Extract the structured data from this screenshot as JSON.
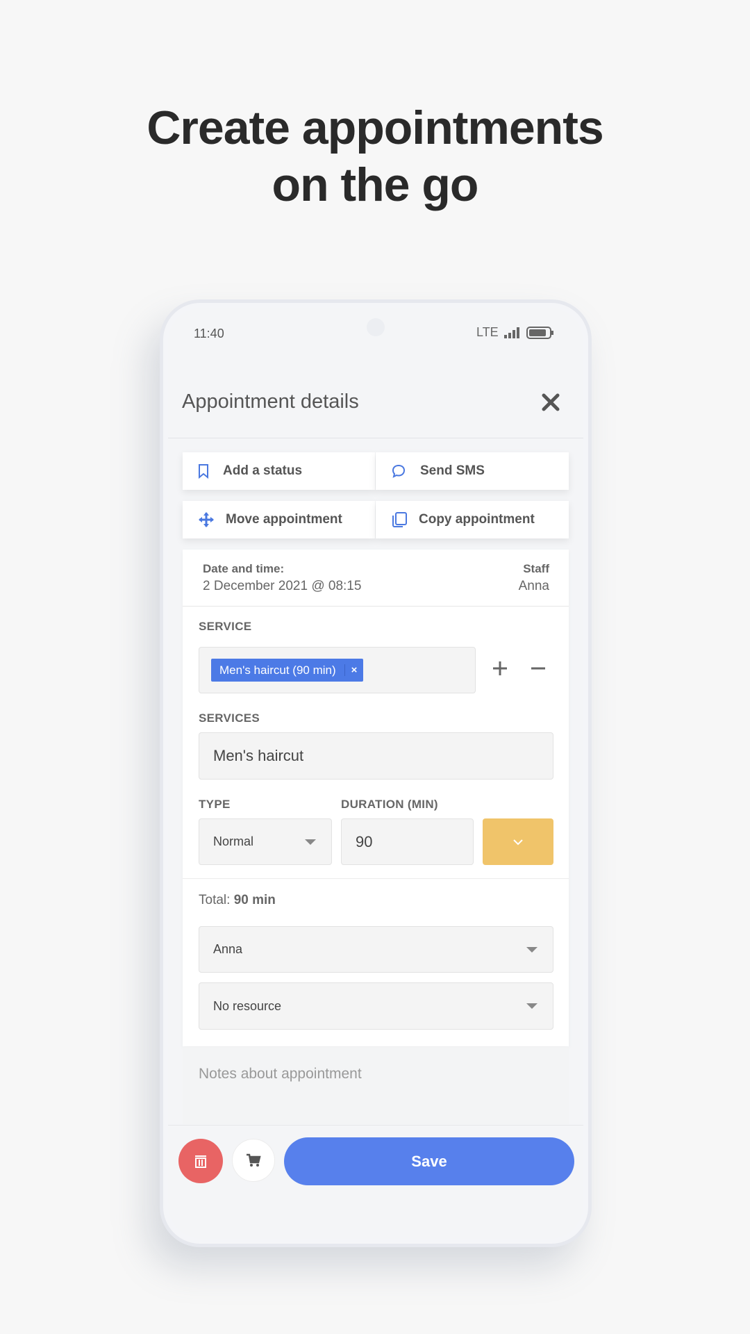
{
  "headline": {
    "line1": "Create appointments",
    "line2": "on the go"
  },
  "status_bar": {
    "time": "11:40",
    "network": "LTE"
  },
  "header": {
    "title": "Appointment details"
  },
  "actions": {
    "add_status": "Add a status",
    "send_sms": "Send SMS",
    "move": "Move appointment",
    "copy": "Copy appointment"
  },
  "info": {
    "date_label": "Date and time:",
    "date_value": "2 December 2021 @ 08:15",
    "staff_label": "Staff",
    "staff_value": "Anna"
  },
  "service": {
    "label": "SERVICE",
    "chip": "Men's haircut (90 min)",
    "chip_remove": "×"
  },
  "services": {
    "label": "SERVICES",
    "value": "Men's haircut"
  },
  "type": {
    "label": "TYPE",
    "value": "Normal"
  },
  "duration": {
    "label": "DURATION (MIN)",
    "value": "90"
  },
  "total": {
    "label": "Total:",
    "value": "90 min"
  },
  "staff_select": {
    "value": "Anna"
  },
  "resource_select": {
    "value": "No resource"
  },
  "notes": {
    "placeholder": "Notes about appointment"
  },
  "footer": {
    "save": "Save"
  },
  "colors": {
    "accent": "#5780ec",
    "delete": "#e86464",
    "yellow": "#f0c46a"
  }
}
